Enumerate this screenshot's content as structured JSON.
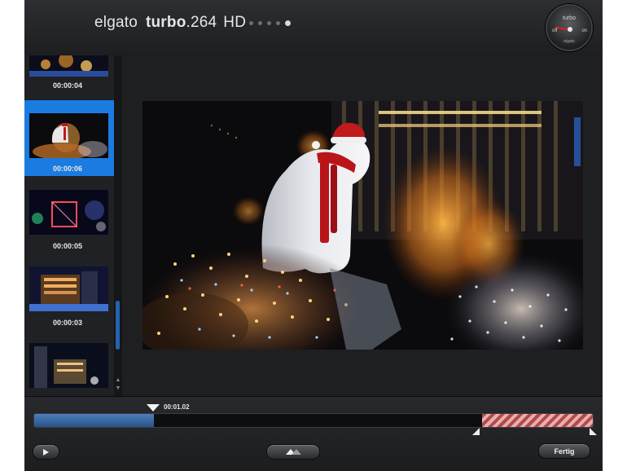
{
  "header": {
    "brand_name": "elgato",
    "product_bold": "turbo",
    "product_suffix": ".264",
    "product_variant": "HD",
    "page_dots": {
      "count": 5,
      "active_index": 4
    },
    "power_gauge": {
      "top_label": "turbo",
      "off_label": "off",
      "on_label": "on",
      "bottom_label": "elgato"
    }
  },
  "clips": [
    {
      "time": "00:00:04",
      "selected": false
    },
    {
      "time": "00:00:06",
      "selected": true
    },
    {
      "time": "00:00:05",
      "selected": false
    },
    {
      "time": "00:00:03",
      "selected": false
    },
    {
      "time": "",
      "selected": false
    }
  ],
  "timeline": {
    "playhead_time": "00:01.02",
    "played_fraction": 0.214,
    "trim_end_fraction": 0.802
  },
  "controls": {
    "play_icon": "play-icon",
    "trim_icon": "trim-icon",
    "done_label": "Fertig"
  },
  "colors": {
    "selected_clip": "#1a7be0",
    "played_bar": "#3b6aa3",
    "trim_stripe": "#b44a4a"
  }
}
